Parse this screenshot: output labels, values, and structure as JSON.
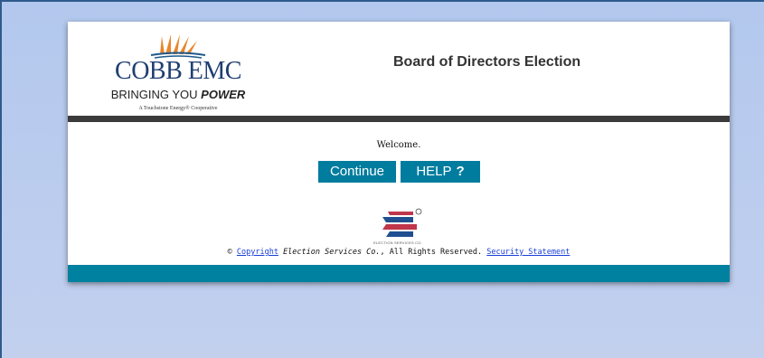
{
  "header": {
    "logo": {
      "word": "COBB EMC",
      "tagline_prefix": "BRINGING YOU ",
      "tagline_power": "POWER",
      "sub": "A Touchstone Energy® Cooperative"
    },
    "title": "Board of Directors Election"
  },
  "main": {
    "welcome": "Welcome.",
    "continue_label": "Continue",
    "help_label": "HELP",
    "help_icon": "?",
    "es_logo_name": "ELECTION SERVICES CO."
  },
  "footer": {
    "copyright_symbol": "©",
    "copyright_link": "Copyright",
    "company": "Election Services Co.",
    "rights": ", All Rights Reserved.",
    "security_link": "Security Statement"
  },
  "colors": {
    "page_bg": "#b3c8ee",
    "accent": "#007c9e",
    "divider": "#3b3b3b",
    "link": "#1a3fd6"
  }
}
